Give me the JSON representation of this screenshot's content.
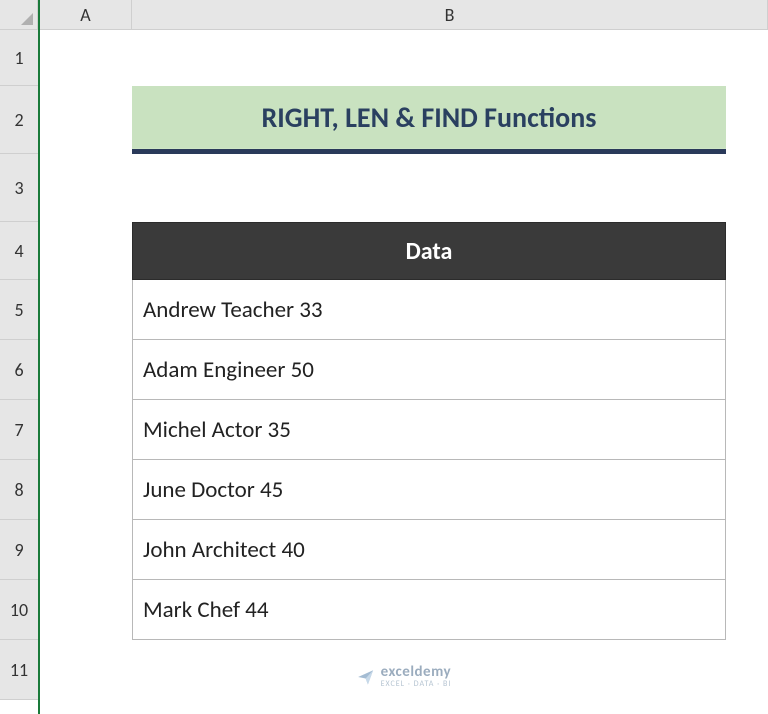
{
  "columns": [
    "A",
    "B"
  ],
  "rows": [
    "1",
    "2",
    "3",
    "4",
    "5",
    "6",
    "7",
    "8",
    "9",
    "10",
    "11"
  ],
  "title": "RIGHT, LEN & FIND Functions",
  "table": {
    "header": "Data",
    "values": [
      "Andrew Teacher 33",
      "Adam Engineer 50",
      "Michel Actor 35",
      "June Doctor 45",
      "John Architect 40",
      "Mark Chef 44"
    ]
  },
  "watermark": {
    "main": "exceldemy",
    "sub": "EXCEL · DATA · BI"
  }
}
